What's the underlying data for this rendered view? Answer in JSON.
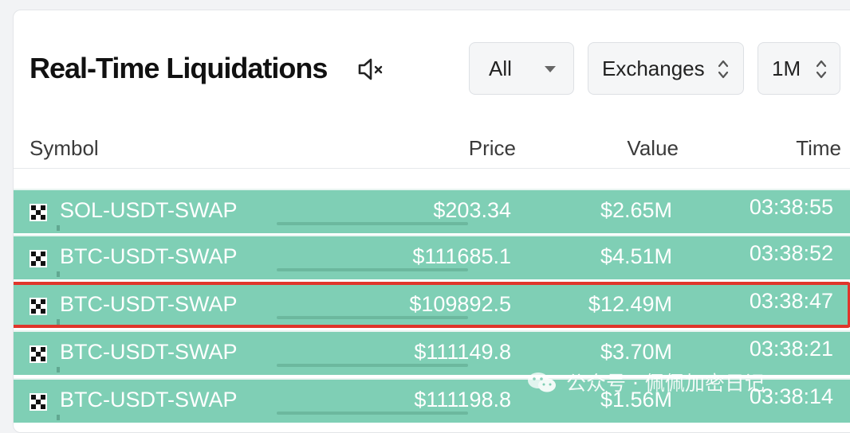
{
  "header": {
    "title": "Real-Time Liquidations",
    "mute_icon": "speaker-muted-icon"
  },
  "filters": {
    "side": {
      "value": "All",
      "icon": "caret-down-icon"
    },
    "exchanges": {
      "value": "Exchanges",
      "icon": "updown-chevron-icon"
    },
    "timeframe": {
      "value": "1M",
      "icon": "updown-chevron-icon"
    }
  },
  "table": {
    "columns": {
      "symbol": "Symbol",
      "price": "Price",
      "value": "Value",
      "time": "Time"
    },
    "rows": [
      {
        "symbol": "SOL-USDT-SWAP",
        "price": "$203.34",
        "value": "$2.65M",
        "time": "03:38:55"
      },
      {
        "symbol": "BTC-USDT-SWAP",
        "price": "$111685.1",
        "value": "$4.51M",
        "time": "03:38:52"
      },
      {
        "symbol": "BTC-USDT-SWAP",
        "price": "$109892.5",
        "value": "$12.49M",
        "time": "03:38:47"
      },
      {
        "symbol": "BTC-USDT-SWAP",
        "price": "$111149.8",
        "value": "$3.70M",
        "time": "03:38:21"
      },
      {
        "symbol": "BTC-USDT-SWAP",
        "price": "$111198.8",
        "value": "$1.56M",
        "time": "03:38:14"
      }
    ],
    "row_color": "#7fcfb5",
    "highlight_color": "#e0352b",
    "exchange_icon": "okx-logo-icon"
  },
  "watermark": {
    "text": "公众号 · 佩佩加密日记",
    "icon": "wechat-icon"
  }
}
